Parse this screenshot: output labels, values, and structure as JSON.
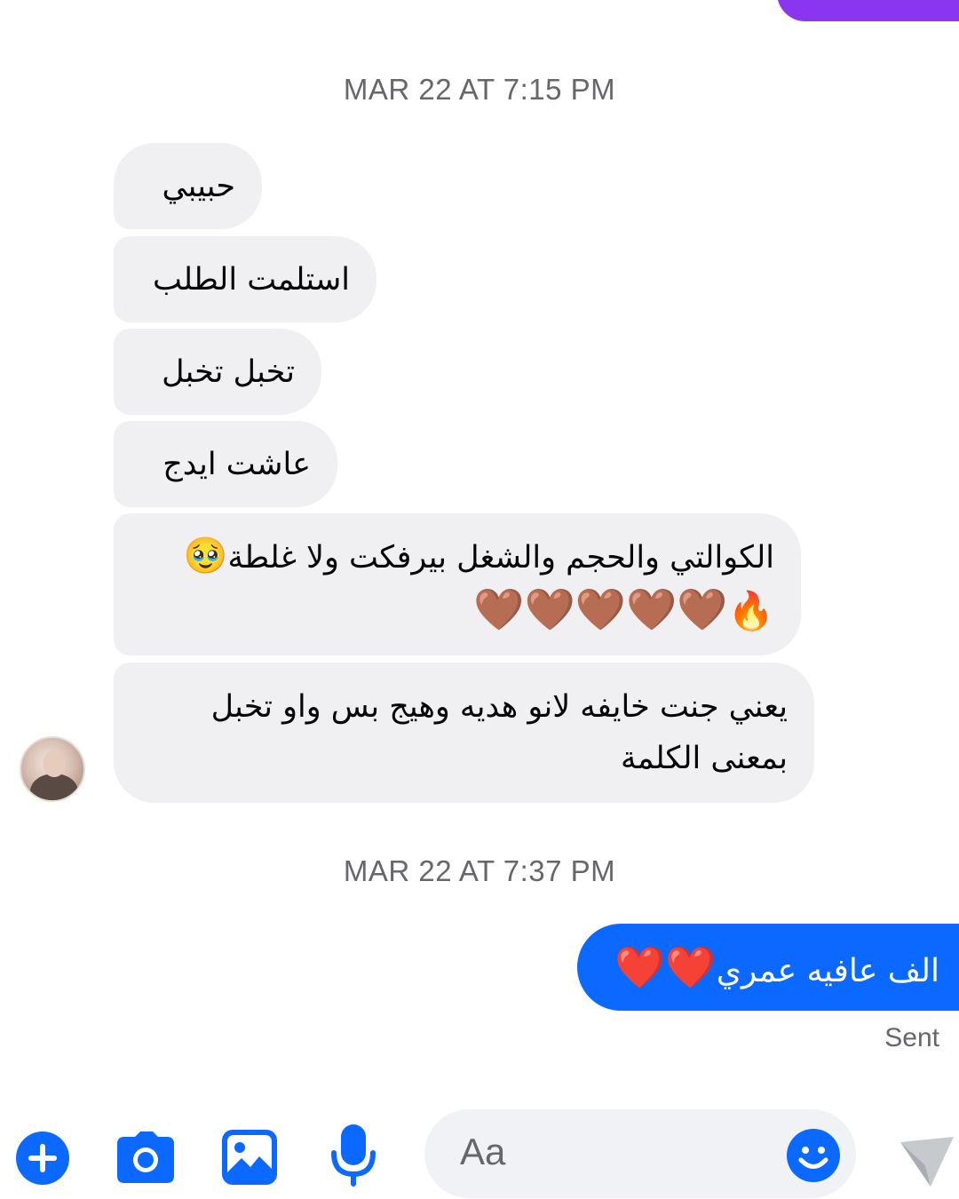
{
  "thread": {
    "timestamp_1": "MAR 22 AT 7:15 PM",
    "timestamp_2": "MAR 22 AT 7:37 PM",
    "incoming": [
      {
        "text": "حبيبي"
      },
      {
        "text": "استلمت الطلب"
      },
      {
        "text": "تخبل تخبل"
      },
      {
        "text": "عاشت ايدج"
      },
      {
        "line1": "الكوالتي والحجم والشغل بيرفكت ولا غلطة",
        "emoji1": "🥹",
        "line2_fire": "🔥",
        "line2_hearts": "🤎🤎🤎🤎🤎"
      },
      {
        "line1": "يعني جنت خايفه لانو هديه وهيج بس واو تخبل",
        "line2": "بمعنى الكلمة"
      }
    ],
    "outgoing": {
      "text": "الف عافيه عمري",
      "hearts": "❤️❤️",
      "status": "Sent"
    }
  },
  "composer": {
    "placeholder": "Aa",
    "icons": [
      "plus-icon",
      "camera-icon",
      "gallery-icon",
      "microphone-icon",
      "emoji-icon",
      "send-icon"
    ],
    "accent_color": "#0b69ff"
  },
  "colors": {
    "incoming_bubble": "#f0f0f2",
    "outgoing_bubble": "#0b69ff",
    "previous_bubble": "#8a35f0",
    "timestamp": "#65676b"
  }
}
